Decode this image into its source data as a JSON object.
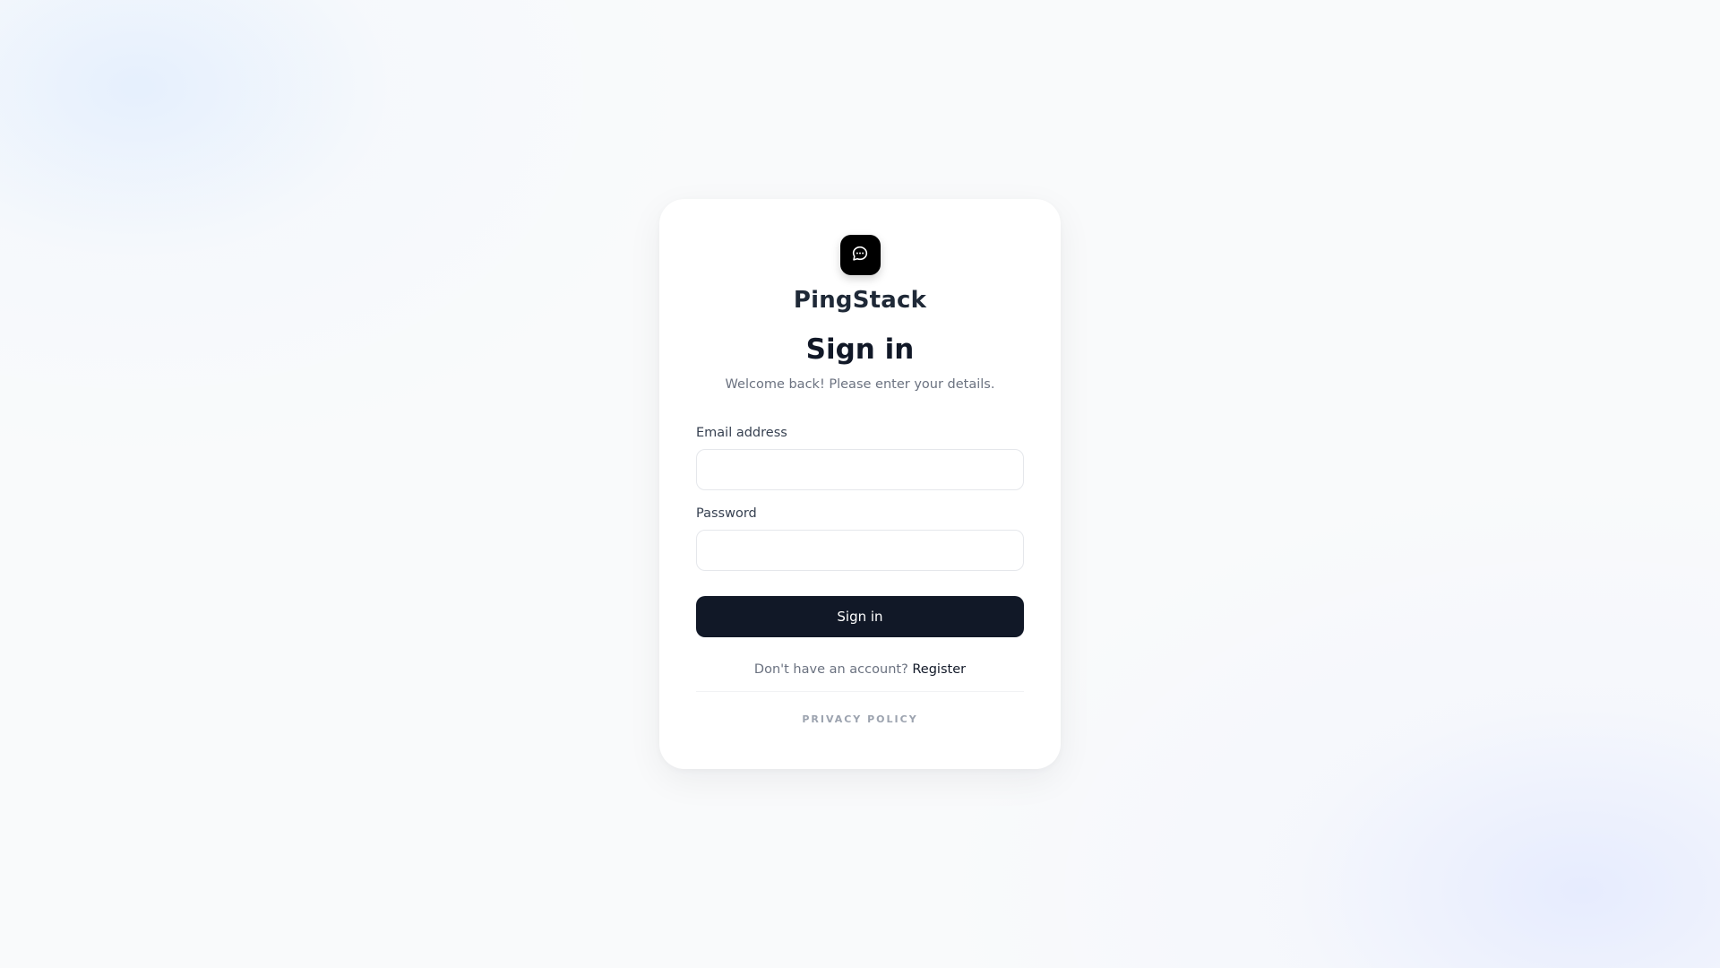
{
  "brand": {
    "name": "PingStack",
    "logo_icon": "chat-bubble-icon",
    "logo_color": "#000000"
  },
  "form": {
    "title": "Sign in",
    "subtitle": "Welcome back! Please enter your details.",
    "email_label": "Email address",
    "email_value": "",
    "email_placeholder": "",
    "password_label": "Password",
    "password_value": "",
    "password_placeholder": "",
    "submit_label": "Sign in",
    "submit_color": "#111827"
  },
  "footer": {
    "register_prompt": "Don't have an account?",
    "register_link": "Register",
    "privacy_link": "PRIVACY POLICY"
  }
}
